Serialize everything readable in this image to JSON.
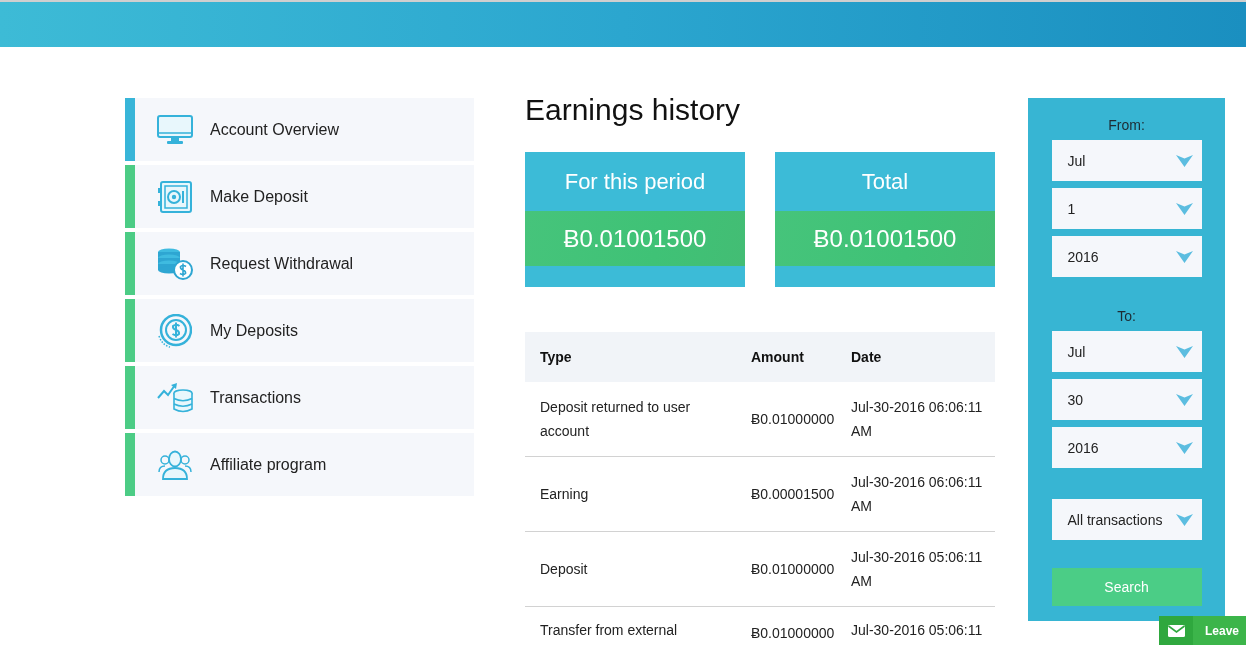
{
  "sidebar": {
    "items": [
      {
        "label": "Account Overview",
        "selected": true
      },
      {
        "label": "Make Deposit",
        "selected": false
      },
      {
        "label": "Request Withdrawal",
        "selected": false
      },
      {
        "label": "My Deposits",
        "selected": false
      },
      {
        "label": "Transactions",
        "selected": false
      },
      {
        "label": "Affiliate program",
        "selected": false
      }
    ]
  },
  "title": "Earnings history",
  "summary_cards": [
    {
      "label": "For this period",
      "amount": "Ƀ0.01001500"
    },
    {
      "label": "Total",
      "amount": "Ƀ0.01001500"
    }
  ],
  "table": {
    "columns": [
      "Type",
      "Amount",
      "Date"
    ],
    "rows": [
      [
        "Deposit returned to user account",
        "Ƀ0.01000000",
        "Jul-30-2016 06:06:11 AM"
      ],
      [
        "Earning",
        "Ƀ0.00001500",
        "Jul-30-2016 06:06:11 AM"
      ],
      [
        "Deposit",
        "Ƀ0.01000000",
        "Jul-30-2016 05:06:11 AM"
      ],
      [
        "Transfer from external",
        "Ƀ0.01000000",
        "Jul-30-2016 05:06:11"
      ]
    ]
  },
  "filter": {
    "from": {
      "label": "From:",
      "month": "Jul",
      "day": "1",
      "year": "2016"
    },
    "to": {
      "label": "To:",
      "month": "Jul",
      "day": "30",
      "year": "2016"
    },
    "transaction_type": "All transactions",
    "search_button": "Search"
  },
  "chat_tab": {
    "label": "Leave"
  }
}
